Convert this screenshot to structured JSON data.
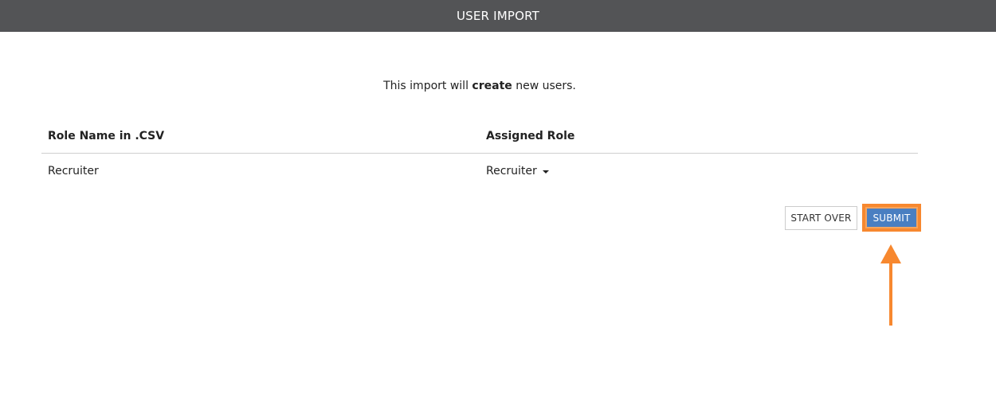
{
  "header": {
    "title": "USER IMPORT"
  },
  "intro": {
    "before": "This import will ",
    "emphasis": "create",
    "after": " new users."
  },
  "table": {
    "columns": [
      "Role Name in .CSV",
      "Assigned Role"
    ],
    "rows": [
      {
        "csv_role": "Recruiter",
        "assigned_role": "Recruiter"
      }
    ]
  },
  "actions": {
    "start_over_label": "START OVER",
    "submit_label": "SUBMIT"
  },
  "colors": {
    "header_bg": "#535456",
    "submit_bg": "#4a7fc1",
    "highlight": "#f7882f"
  },
  "icons": {
    "dropdown": "caret-down-icon",
    "annotation": "arrow-up-icon"
  }
}
